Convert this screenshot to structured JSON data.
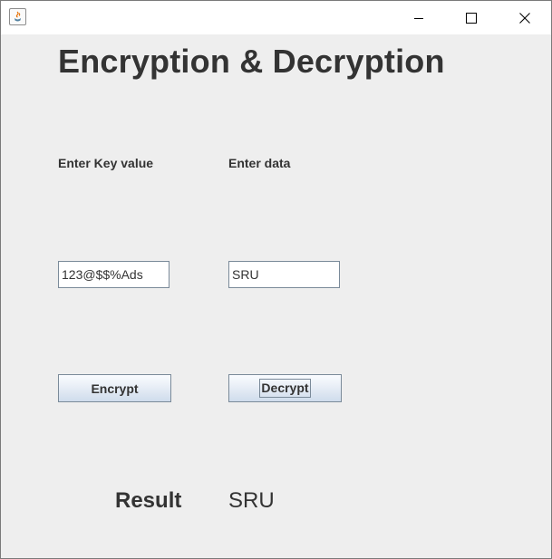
{
  "window": {
    "title": "",
    "controls": [
      "minimize-icon",
      "maximize-icon",
      "close-icon"
    ]
  },
  "app_title": "Encryption & Decryption",
  "form": {
    "key_label": "Enter Key value",
    "data_label": "Enter data",
    "key_value": "123@$$%Ads",
    "data_value": "SRU"
  },
  "buttons": {
    "encrypt_label": "Encrypt",
    "decrypt_label": "Decrypt"
  },
  "result": {
    "label": "Result",
    "value": "SRU"
  },
  "colors": {
    "background": "#eeeeee",
    "text": "#333333",
    "button_border": "#7a8a99"
  }
}
